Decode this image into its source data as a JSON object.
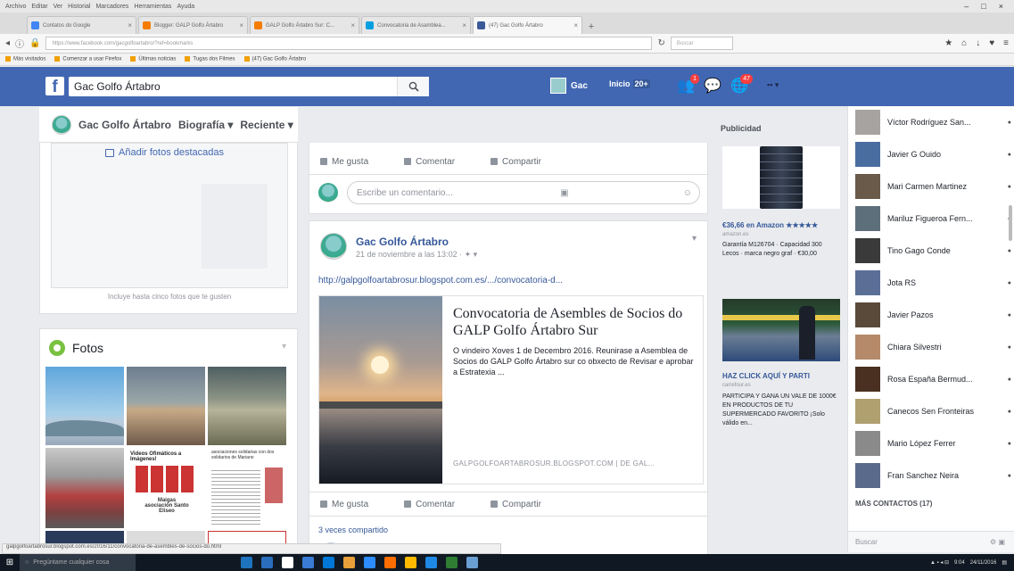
{
  "browser": {
    "menu": [
      "Archivo",
      "Editar",
      "Ver",
      "Historial",
      "Marcadores",
      "Herramientas",
      "Ayuda"
    ],
    "window_controls": [
      "–",
      "□",
      "×"
    ],
    "tabs": [
      {
        "label": "Contatos do Google",
        "color": "#4285f4"
      },
      {
        "label": "Blogger: GALP Golfo Ártabro",
        "color": "#f57c00"
      },
      {
        "label": "GALP Golfo Ártabro Sur: C...",
        "color": "#f57c00"
      },
      {
        "label": "Convocatoria de Asamblea...",
        "color": "#00a0e0"
      },
      {
        "label": "(47) Gac Golfo Ártabro",
        "color": "#3b5998"
      }
    ],
    "url": "https://www.facebook.com/gacgolfoartabro/?ref=bookmarks",
    "search_placeholder": "Buscar",
    "bookmarks": [
      "Más visitados",
      "Comenzar a usar Firefox",
      "Últimas noticias",
      "Tugas dos Filmes",
      "(47) Gac Golfo Ártabro"
    ],
    "status_url": "galpgolfoartabrosur.blogspot.com.es/2016/11/convocatoria-de-asembles-de-socios-do.html"
  },
  "facebook": {
    "search_value": "Gac Golfo Ártabro",
    "user_name": "Gac",
    "home_label": "Inicio",
    "home_badge": "20+",
    "friend_requests_count": "1",
    "notifications_count": "47",
    "page": {
      "name": "Gac Golfo Ártabro",
      "nav": [
        "Biografía ▾",
        "Reciente ▾"
      ]
    },
    "featured": {
      "add_label": "Añadir fotos destacadas",
      "hint": "Incluye hasta cinco fotos que te gusten"
    },
    "photos_title": "Fotos",
    "photo_thumbs": {
      "p5_title": "Videos Ofimáticos a Imágenes!",
      "p5_sub": "Maigas asociación Santo Eliseo",
      "p6_title": "asociaciones solidarias con dos solidarios de Mariano"
    },
    "actions": {
      "like": "Me gusta",
      "comment": "Comentar",
      "share": "Compartir"
    },
    "comment_placeholder": "Escribe un comentario...",
    "post": {
      "author": "Gac Golfo Ártabro",
      "time": "21 de noviembre a las 13:02 · ✦ ▾",
      "link": "http://galpgolfoartabrosur.blogspot.com.es/.../convocatoria-d...",
      "card_title": "Convocatoria de Asembles de Socios do GALP Golfo Ártabro Sur",
      "card_desc": "O vindeiro Xoves 1 de Decembro 2016. Reunirase a Asemblea de Socios do GALP Golfo Ártabro sur co obxecto de Revisar e aprobar a Estratexia ...",
      "card_domain": "GALPGOLFOARTABROSUR.BLOGSPOT.COM | DE GAL...",
      "shares": "3 veces compartido"
    },
    "ads": {
      "title": "Publicidad",
      "ad1_title": "€36,66 en Amazon ★★★★★",
      "ad1_source": "amazon.es",
      "ad1_desc": "Garantía M126704 · Capacidad 300 Lecos · marca negro graf · €30,00",
      "ad2_title": "HAZ CLICK AQUÍ Y PARTI",
      "ad2_source": "carrefour.es",
      "ad2_desc": "PARTICIPA Y GANA UN VALE DE 1000€ EN PRODUCTOS DE TU SUPERMERCADO FAVORITO ¡Solo válido en..."
    },
    "contacts": [
      {
        "name": "Víctor Rodríguez San...",
        "color": "#a7a3a0"
      },
      {
        "name": "Javier G Ouido",
        "color": "#4a6da0"
      },
      {
        "name": "Mari Carmen Martinez",
        "color": "#6a5a4a"
      },
      {
        "name": "Mariluz Figueroa Fern...",
        "color": "#5d6f7a"
      },
      {
        "name": "Tino Gago Conde",
        "color": "#3a3a3a"
      },
      {
        "name": "Jota RS",
        "color": "#5a6e96"
      },
      {
        "name": "Javier Pazos",
        "color": "#5a4a3a"
      },
      {
        "name": "Chiara Silvestri",
        "color": "#b58a6a"
      },
      {
        "name": "Rosa España Bermud...",
        "color": "#4a3020"
      },
      {
        "name": "Canecos Sen Fronteiras",
        "color": "#b0a070"
      },
      {
        "name": "Mario López Ferrer",
        "color": "#8a8a8a"
      },
      {
        "name": "Fran Sanchez Neira",
        "color": "#5a6a8a"
      }
    ],
    "more_contacts": "MÁS CONTACTOS (17)",
    "chat_search_placeholder": "Buscar"
  },
  "taskbar": {
    "search_placeholder": "Pregúntame cualquier cosa",
    "tray_time": "9:04",
    "tray_date": "24/11/2016",
    "app_colors": [
      "#1e73be",
      "#2a6ebd",
      "#ffffff",
      "#3a7bd5",
      "#0078d7",
      "#e8a13a",
      "#2d8cff",
      "#ff6d00",
      "#ffb900",
      "#1e88e5",
      "#2e7d32",
      "#6a9fd4"
    ]
  }
}
